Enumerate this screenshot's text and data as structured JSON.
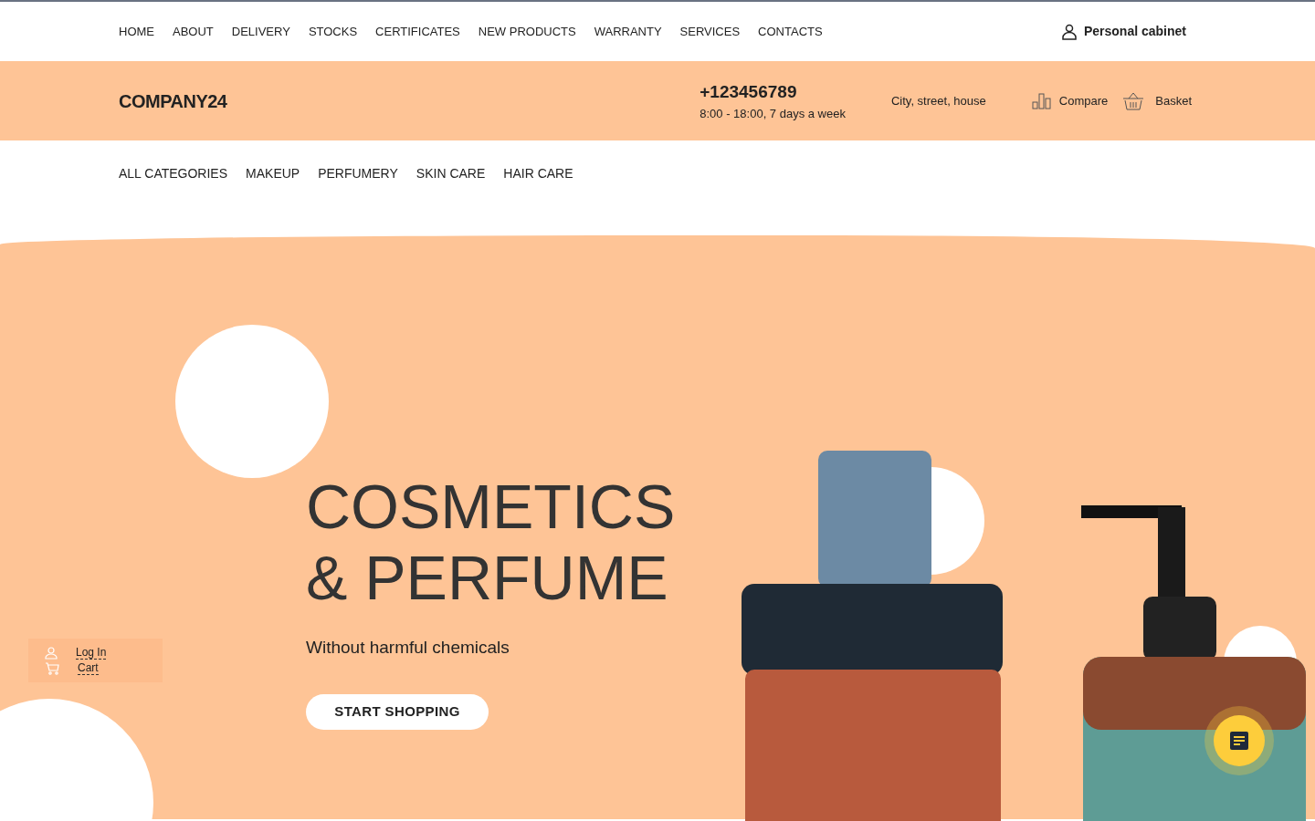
{
  "top_nav": [
    "HOME",
    "ABOUT",
    "DELIVERY",
    "STOCKS",
    "CERTIFICATES",
    "NEW PRODUCTS",
    "WARRANTY",
    "SERVICES",
    "CONTACTS"
  ],
  "personal_cabinet": "Personal cabinet",
  "header": {
    "logo": "COMPANY24",
    "phone": "+123456789",
    "hours": "8:00 - 18:00, 7 days a week",
    "address": "City, street, house",
    "compare": "Compare",
    "basket": "Basket"
  },
  "categories": [
    "ALL CATEGORIES",
    "MAKEUP",
    "PERFUMERY",
    "SKIN CARE",
    "HAIR CARE"
  ],
  "hero": {
    "title_lines": [
      "COSMETICS",
      "& PERFUME"
    ],
    "subtitle": "Without harmful chemicals",
    "button": "START SHOPPING"
  },
  "side_panel": [
    {
      "kind": "login",
      "label": "Log In"
    },
    {
      "kind": "cart",
      "label": "Cart"
    }
  ]
}
